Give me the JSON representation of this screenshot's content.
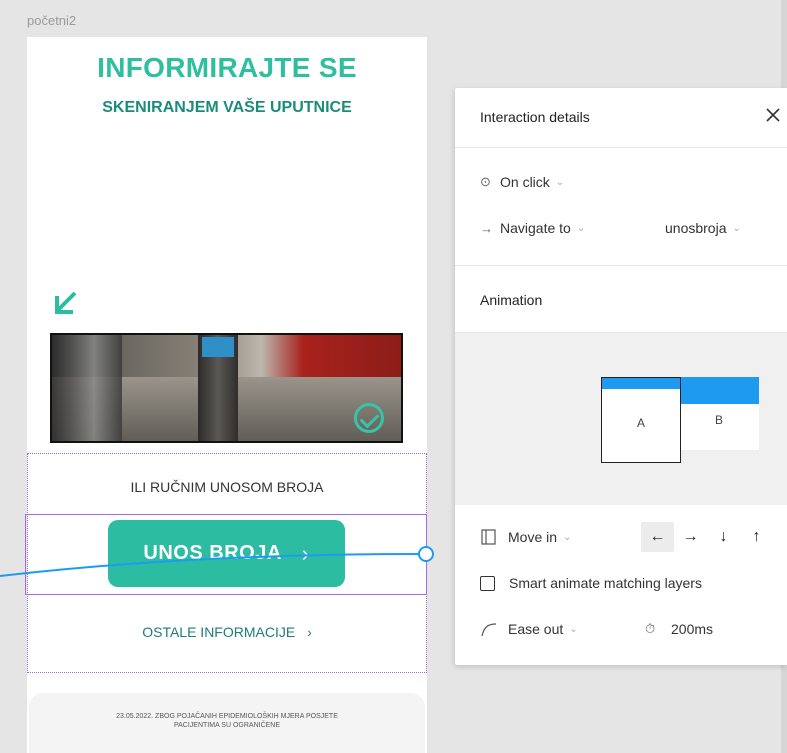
{
  "frame": {
    "label": "početni2",
    "title": "INFORMIRAJTE SE",
    "subtitle": "SKENIRANJEM VAŠE UPUTNICE",
    "manual_label": "ILI RUČNIM UNOSOM BROJA",
    "unos_button": "UNOS BROJA",
    "unos_chevron": "›",
    "ostale_link": "OSTALE INFORMACIJE",
    "ostale_chevron": "›",
    "notice_line1": "23.05.2022. ZBOG POJAČANIH EPIDEMIOLOŠKIH MJERA POSJETE",
    "notice_line2": "PACIJENTIMA SU OGRANIČENE"
  },
  "panel": {
    "title": "Interaction details",
    "close": "✕",
    "trigger": {
      "icon": "⊙",
      "label": "On click",
      "caret": "⌄"
    },
    "action": {
      "icon": "→",
      "label": "Navigate to",
      "caret": "⌄"
    },
    "destination": {
      "label": "unosbroja",
      "caret": "⌄"
    },
    "animation_title": "Animation",
    "preview": {
      "a_label": "A",
      "b_label": "B"
    },
    "transition": {
      "label": "Move in",
      "caret": "⌄"
    },
    "directions": [
      "←",
      "→",
      "↓",
      "↑"
    ],
    "smart_animate": "Smart animate matching layers",
    "easing": {
      "label": "Ease out",
      "caret": "⌄"
    },
    "duration": {
      "icon": "⏱",
      "value": "200ms"
    }
  },
  "colors": {
    "accent": "#2cbca2",
    "heading": "#2fbfa0",
    "selection": "#a66ae6",
    "connector": "#1e9bf0"
  }
}
